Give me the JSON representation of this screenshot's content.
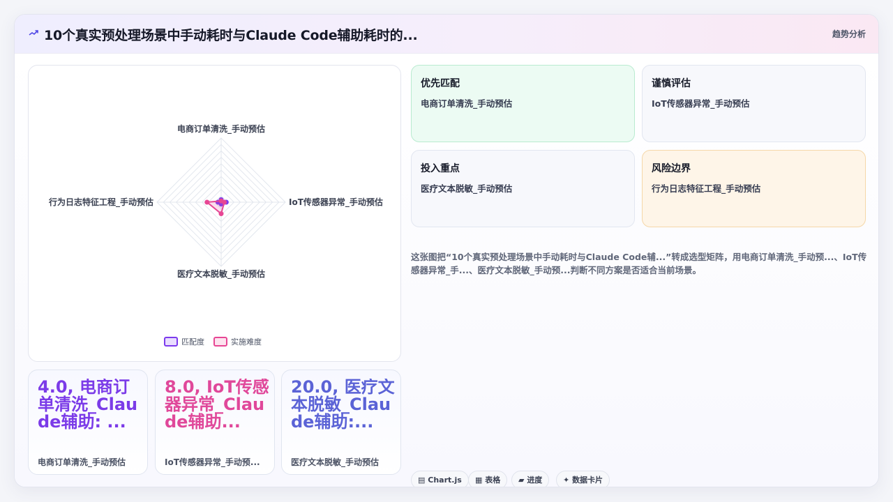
{
  "header": {
    "title": "10个真实预处理场景中手动耗时与Claude Code辅助耗时的...",
    "tag": "趋势分析"
  },
  "chart_data": {
    "type": "radar",
    "axes": [
      "电商订单清洗_手动预估",
      "IoT传感器异常_手动预估",
      "医疗文本脱敏_手动预估",
      "行为日志特征工程_手动预估"
    ],
    "range": [
      0,
      100
    ],
    "grid": true,
    "legend_position": "bottom",
    "series": [
      {
        "name": "匹配度",
        "values": [
          4,
          8,
          3,
          5
        ]
      },
      {
        "name": "实施难度",
        "values": [
          2,
          5,
          18,
          22
        ]
      }
    ]
  },
  "colors": {
    "series1": "#7c3aed",
    "series2": "#e74694",
    "kpi1": "#7b3be8",
    "kpi2": "#e0489a",
    "kpi3": "#5b63d6"
  },
  "kpis": [
    {
      "value": "4.0, 电商订单清洗_Claude辅助: ...",
      "label": "电商订单清洗_手动预估"
    },
    {
      "value": "8.0, IoT传感器异常_Claude辅助...",
      "label": "IoT传感器异常_手动预..."
    },
    {
      "value": "20.0, 医疗文本脱敏_Claude辅助:...",
      "label": "医疗文本脱敏_手动预估"
    }
  ],
  "quadrants": [
    {
      "title": "优先匹配",
      "text": "电商订单清洗_手动预估"
    },
    {
      "title": "谨慎评估",
      "text": "IoT传感器异常_手动预估"
    },
    {
      "title": "投入重点",
      "text": "医疗文本脱敏_手动预估"
    },
    {
      "title": "风险边界",
      "text": "行为日志特征工程_手动预估"
    }
  ],
  "description": "这张图把“10个真实预处理场景中手动耗时与Claude Code辅...”转成选型矩阵，用电商订单清洗_手动预...、IoT传感器异常_手...、医疗文本脱敏_手动预...判断不同方案是否适合当前场景。",
  "chips": [
    {
      "icon": "chart-icon",
      "label": "Chart.js"
    },
    {
      "icon": "table-icon",
      "label": "表格"
    },
    {
      "icon": "progress-icon",
      "label": "进度"
    },
    {
      "icon": "sparkle-icon",
      "label": "数据卡片"
    }
  ]
}
